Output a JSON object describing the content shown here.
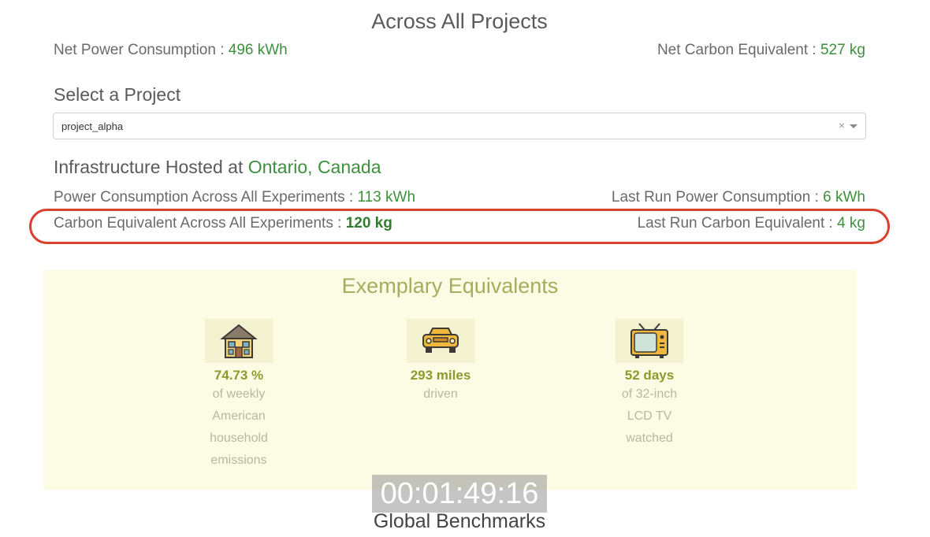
{
  "header": {
    "title": "Across All Projects"
  },
  "net": {
    "power_label": "Net Power Consumption : ",
    "power_value": "496 kWh",
    "carbon_label": "Net Carbon Equivalent : ",
    "carbon_value": "527 kg"
  },
  "project_select": {
    "label": "Select a Project",
    "value": "project_alpha",
    "clear_glyph": "×"
  },
  "infrastructure": {
    "label": "Infrastructure Hosted at ",
    "location": "Ontario, Canada"
  },
  "power": {
    "all_label": "Power Consumption Across All Experiments : ",
    "all_value": "113 kWh",
    "last_label": "Last Run Power Consumption : ",
    "last_value": "6 kWh"
  },
  "carbon": {
    "all_label": "Carbon Equivalent Across All Experiments : ",
    "all_value": "120 kg",
    "last_label": "Last Run Carbon Equivalent : ",
    "last_value": "4 kg"
  },
  "equivalents": {
    "title": "Exemplary Equivalents",
    "items": [
      {
        "icon": "house-icon",
        "value": "74.73 %",
        "desc": [
          "of weekly",
          "American",
          "household",
          "emissions"
        ]
      },
      {
        "icon": "car-icon",
        "value": "293 miles",
        "desc": [
          "driven"
        ]
      },
      {
        "icon": "tv-icon",
        "value": "52 days",
        "desc": [
          "of 32-inch",
          "LCD TV",
          "watched"
        ]
      }
    ]
  },
  "video_overlay": {
    "timer": "00:01:49:16"
  },
  "footer": {
    "next_section": "Global Benchmarks"
  },
  "colors": {
    "accent_green": "#3e8f3e",
    "highlight_red": "#d9412f",
    "panel_bg": "#fcfbe4",
    "equiv_value": "#8b9a2d"
  }
}
